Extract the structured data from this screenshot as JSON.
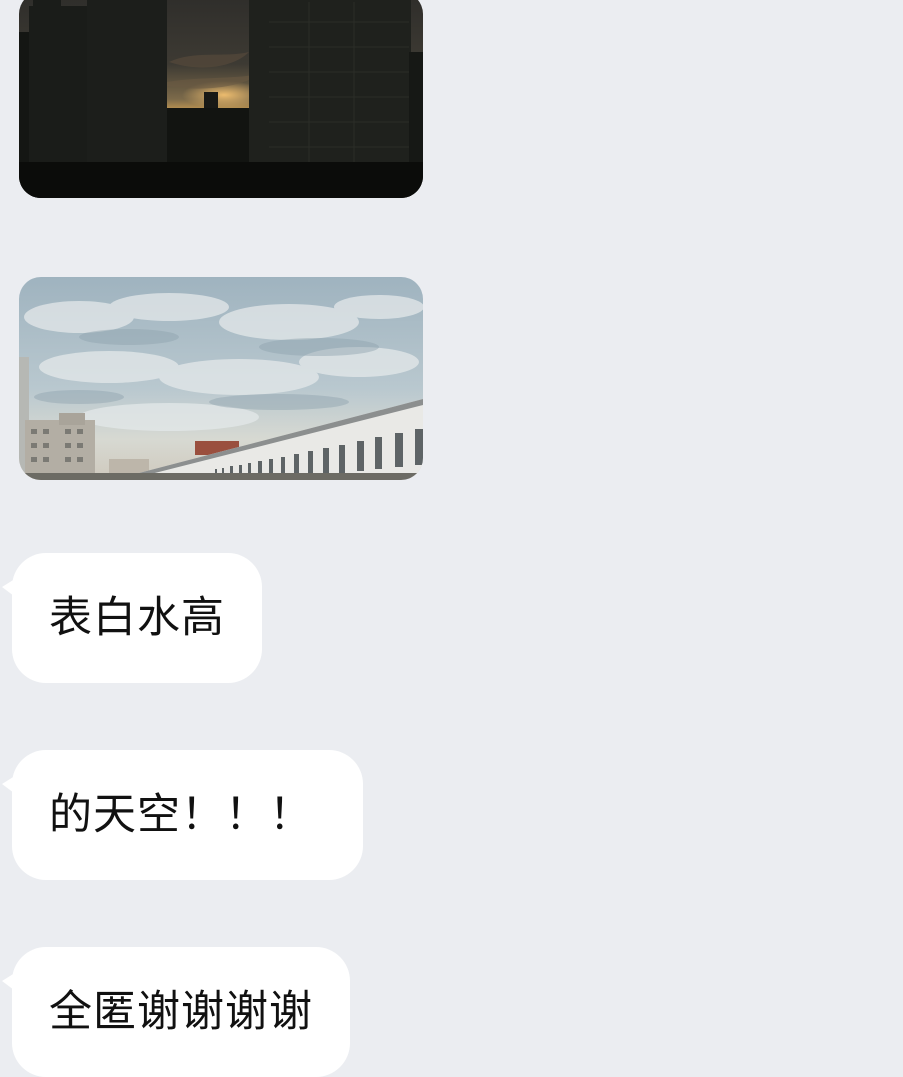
{
  "conversation": {
    "photos": [
      {
        "icon": "dusk-skyline-photo"
      },
      {
        "icon": "cloudy-sky-building-photo"
      }
    ],
    "messages": [
      {
        "text": "表白水高"
      },
      {
        "text": "的天空！！！"
      },
      {
        "text": "全匿谢谢谢谢"
      }
    ]
  },
  "theme": {
    "background": "#ebedf1",
    "bubble": "#ffffff",
    "text": "#111111"
  }
}
